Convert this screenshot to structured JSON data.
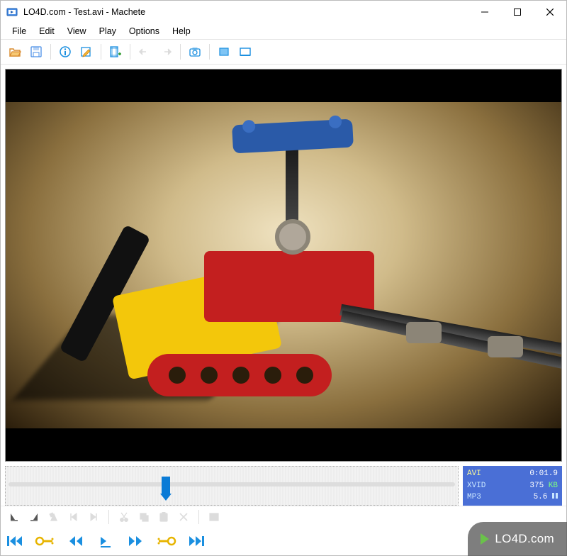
{
  "title": "LO4D.com - Test.avi - Machete",
  "menu": {
    "file": "File",
    "edit": "Edit",
    "view": "View",
    "play": "Play",
    "options": "Options",
    "help": "Help"
  },
  "toolbar": {
    "open": "open-icon",
    "save": "save-icon",
    "info": "info-icon",
    "edit_tags": "edit-tags-icon",
    "add_stream": "add-stream-icon",
    "undo": "undo-icon",
    "redo": "redo-icon",
    "snapshot": "snapshot-icon",
    "fit": "fit-icon",
    "fullscreen": "fullscreen-icon"
  },
  "edit_toolbar": {
    "sel_start": "selection-start-icon",
    "sel_end": "selection-end-icon",
    "clear_sel": "clear-selection-icon",
    "goto_start": "goto-sel-start-icon",
    "goto_end": "goto-sel-end-icon",
    "cut": "cut-icon",
    "copy": "copy-icon",
    "paste": "paste-icon",
    "delete": "delete-icon",
    "list": "list-icon"
  },
  "transport": {
    "skip_begin": "skip-begin-icon",
    "prev_key": "prev-keyframe-icon",
    "step_back": "step-back-icon",
    "play_pause": "play-pause-icon",
    "step_fwd": "step-forward-icon",
    "next_key": "next-keyframe-icon",
    "skip_end": "skip-end-icon"
  },
  "status": {
    "container": "AVI",
    "time": "0:01.9",
    "video_codec": "XVID",
    "video_bitrate": "375",
    "video_unit": "KB",
    "audio_codec": "MP3",
    "audio_bitrate": "5.6"
  },
  "watermark": "LO4D.com",
  "timeline": {
    "position_percent": 34
  },
  "colors": {
    "accent": "#0a7bd6",
    "status_bg": "#4a6fd6",
    "key_yellow": "#e7b400"
  }
}
